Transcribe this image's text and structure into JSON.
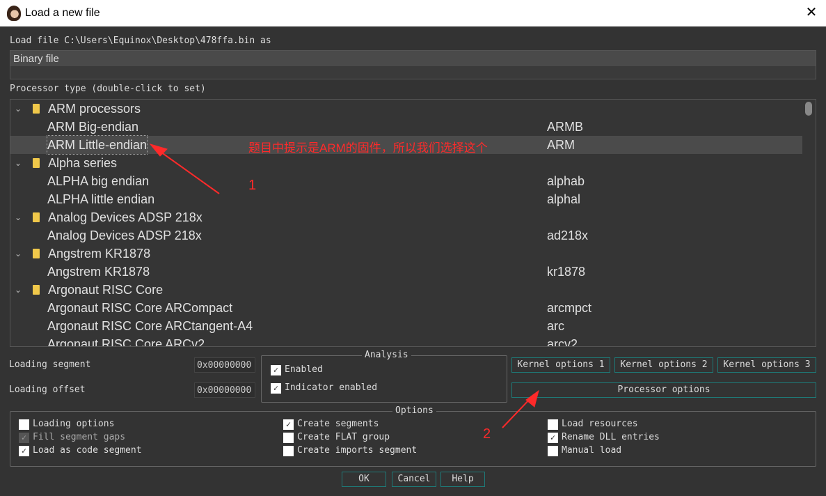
{
  "window": {
    "title": "Load a new file",
    "close_icon": "close-icon"
  },
  "load_file_label": "Load file C:\\Users\\Equinox\\Desktop\\478ffa.bin as",
  "file_type": {
    "selected": "Binary file"
  },
  "processor_type_label": "Processor type (double-click to set)",
  "processors": [
    {
      "type": "group",
      "name": "ARM processors"
    },
    {
      "type": "item",
      "name": "ARM Big-endian",
      "code": "ARMB"
    },
    {
      "type": "item",
      "name": "ARM Little-endian",
      "code": "ARM",
      "selected": true
    },
    {
      "type": "group",
      "name": "Alpha series"
    },
    {
      "type": "item",
      "name": "ALPHA big endian",
      "code": "alphab"
    },
    {
      "type": "item",
      "name": "ALPHA little endian",
      "code": "alphal"
    },
    {
      "type": "group",
      "name": "Analog Devices ADSP 218x"
    },
    {
      "type": "item",
      "name": "Analog Devices ADSP 218x",
      "code": "ad218x"
    },
    {
      "type": "group",
      "name": "Angstrem KR1878"
    },
    {
      "type": "item",
      "name": "Angstrem KR1878",
      "code": "kr1878"
    },
    {
      "type": "group",
      "name": "Argonaut RISC Core"
    },
    {
      "type": "item",
      "name": "Argonaut RISC Core ARCompact",
      "code": "arcmpct"
    },
    {
      "type": "item",
      "name": "Argonaut RISC Core ARCtangent-A4",
      "code": "arc"
    },
    {
      "type": "item",
      "name": "Argonaut RISC Core ARCv2",
      "code": "arcv2"
    }
  ],
  "loading_segment": {
    "label": "Loading segment",
    "value": "0x00000000"
  },
  "loading_offset": {
    "label": "Loading offset",
    "value": "0x00000000"
  },
  "analysis": {
    "title": "Analysis",
    "enabled": {
      "label": "Enabled",
      "checked": true
    },
    "indicator": {
      "label": "Indicator enabled",
      "checked": true
    }
  },
  "kernel_buttons": [
    "Kernel options 1",
    "Kernel options 2",
    "Kernel options 3"
  ],
  "processor_options_label": "Processor options",
  "options": {
    "title": "Options",
    "items": [
      {
        "label": "Loading options",
        "checked": false
      },
      {
        "label": "Fill segment gaps",
        "checked": true,
        "disabled": true
      },
      {
        "label": "Load as code segment",
        "checked": true
      },
      {
        "label": "Create segments",
        "checked": true
      },
      {
        "label": "Create FLAT group",
        "checked": false
      },
      {
        "label": "Create imports segment",
        "checked": false
      },
      {
        "label": "Load resources",
        "checked": false
      },
      {
        "label": "Rename DLL entries",
        "checked": true
      },
      {
        "label": "Manual load",
        "checked": false
      }
    ]
  },
  "buttons": {
    "ok": "OK",
    "cancel": "Cancel",
    "help": "Help"
  },
  "annotations": {
    "note": "题目中提示是ARM的固件，所以我们选择这个",
    "marker1": "1",
    "marker2": "2",
    "color": "#ff2a2a"
  }
}
